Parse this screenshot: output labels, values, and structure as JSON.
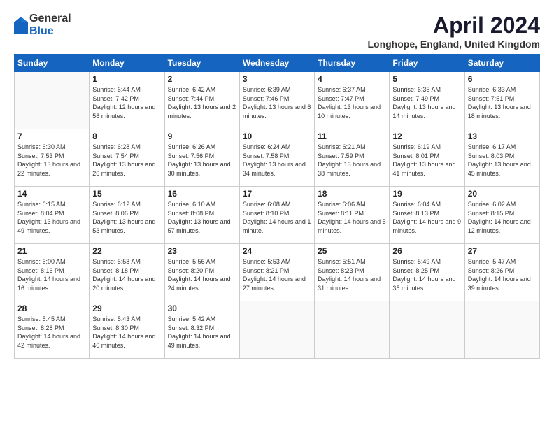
{
  "logo": {
    "general": "General",
    "blue": "Blue"
  },
  "title": "April 2024",
  "location": "Longhope, England, United Kingdom",
  "days_header": [
    "Sunday",
    "Monday",
    "Tuesday",
    "Wednesday",
    "Thursday",
    "Friday",
    "Saturday"
  ],
  "weeks": [
    [
      {
        "day": "",
        "sunrise": "",
        "sunset": "",
        "daylight": ""
      },
      {
        "day": "1",
        "sunrise": "Sunrise: 6:44 AM",
        "sunset": "Sunset: 7:42 PM",
        "daylight": "Daylight: 12 hours and 58 minutes."
      },
      {
        "day": "2",
        "sunrise": "Sunrise: 6:42 AM",
        "sunset": "Sunset: 7:44 PM",
        "daylight": "Daylight: 13 hours and 2 minutes."
      },
      {
        "day": "3",
        "sunrise": "Sunrise: 6:39 AM",
        "sunset": "Sunset: 7:46 PM",
        "daylight": "Daylight: 13 hours and 6 minutes."
      },
      {
        "day": "4",
        "sunrise": "Sunrise: 6:37 AM",
        "sunset": "Sunset: 7:47 PM",
        "daylight": "Daylight: 13 hours and 10 minutes."
      },
      {
        "day": "5",
        "sunrise": "Sunrise: 6:35 AM",
        "sunset": "Sunset: 7:49 PM",
        "daylight": "Daylight: 13 hours and 14 minutes."
      },
      {
        "day": "6",
        "sunrise": "Sunrise: 6:33 AM",
        "sunset": "Sunset: 7:51 PM",
        "daylight": "Daylight: 13 hours and 18 minutes."
      }
    ],
    [
      {
        "day": "7",
        "sunrise": "Sunrise: 6:30 AM",
        "sunset": "Sunset: 7:53 PM",
        "daylight": "Daylight: 13 hours and 22 minutes."
      },
      {
        "day": "8",
        "sunrise": "Sunrise: 6:28 AM",
        "sunset": "Sunset: 7:54 PM",
        "daylight": "Daylight: 13 hours and 26 minutes."
      },
      {
        "day": "9",
        "sunrise": "Sunrise: 6:26 AM",
        "sunset": "Sunset: 7:56 PM",
        "daylight": "Daylight: 13 hours and 30 minutes."
      },
      {
        "day": "10",
        "sunrise": "Sunrise: 6:24 AM",
        "sunset": "Sunset: 7:58 PM",
        "daylight": "Daylight: 13 hours and 34 minutes."
      },
      {
        "day": "11",
        "sunrise": "Sunrise: 6:21 AM",
        "sunset": "Sunset: 7:59 PM",
        "daylight": "Daylight: 13 hours and 38 minutes."
      },
      {
        "day": "12",
        "sunrise": "Sunrise: 6:19 AM",
        "sunset": "Sunset: 8:01 PM",
        "daylight": "Daylight: 13 hours and 41 minutes."
      },
      {
        "day": "13",
        "sunrise": "Sunrise: 6:17 AM",
        "sunset": "Sunset: 8:03 PM",
        "daylight": "Daylight: 13 hours and 45 minutes."
      }
    ],
    [
      {
        "day": "14",
        "sunrise": "Sunrise: 6:15 AM",
        "sunset": "Sunset: 8:04 PM",
        "daylight": "Daylight: 13 hours and 49 minutes."
      },
      {
        "day": "15",
        "sunrise": "Sunrise: 6:12 AM",
        "sunset": "Sunset: 8:06 PM",
        "daylight": "Daylight: 13 hours and 53 minutes."
      },
      {
        "day": "16",
        "sunrise": "Sunrise: 6:10 AM",
        "sunset": "Sunset: 8:08 PM",
        "daylight": "Daylight: 13 hours and 57 minutes."
      },
      {
        "day": "17",
        "sunrise": "Sunrise: 6:08 AM",
        "sunset": "Sunset: 8:10 PM",
        "daylight": "Daylight: 14 hours and 1 minute."
      },
      {
        "day": "18",
        "sunrise": "Sunrise: 6:06 AM",
        "sunset": "Sunset: 8:11 PM",
        "daylight": "Daylight: 14 hours and 5 minutes."
      },
      {
        "day": "19",
        "sunrise": "Sunrise: 6:04 AM",
        "sunset": "Sunset: 8:13 PM",
        "daylight": "Daylight: 14 hours and 9 minutes."
      },
      {
        "day": "20",
        "sunrise": "Sunrise: 6:02 AM",
        "sunset": "Sunset: 8:15 PM",
        "daylight": "Daylight: 14 hours and 12 minutes."
      }
    ],
    [
      {
        "day": "21",
        "sunrise": "Sunrise: 6:00 AM",
        "sunset": "Sunset: 8:16 PM",
        "daylight": "Daylight: 14 hours and 16 minutes."
      },
      {
        "day": "22",
        "sunrise": "Sunrise: 5:58 AM",
        "sunset": "Sunset: 8:18 PM",
        "daylight": "Daylight: 14 hours and 20 minutes."
      },
      {
        "day": "23",
        "sunrise": "Sunrise: 5:56 AM",
        "sunset": "Sunset: 8:20 PM",
        "daylight": "Daylight: 14 hours and 24 minutes."
      },
      {
        "day": "24",
        "sunrise": "Sunrise: 5:53 AM",
        "sunset": "Sunset: 8:21 PM",
        "daylight": "Daylight: 14 hours and 27 minutes."
      },
      {
        "day": "25",
        "sunrise": "Sunrise: 5:51 AM",
        "sunset": "Sunset: 8:23 PM",
        "daylight": "Daylight: 14 hours and 31 minutes."
      },
      {
        "day": "26",
        "sunrise": "Sunrise: 5:49 AM",
        "sunset": "Sunset: 8:25 PM",
        "daylight": "Daylight: 14 hours and 35 minutes."
      },
      {
        "day": "27",
        "sunrise": "Sunrise: 5:47 AM",
        "sunset": "Sunset: 8:26 PM",
        "daylight": "Daylight: 14 hours and 39 minutes."
      }
    ],
    [
      {
        "day": "28",
        "sunrise": "Sunrise: 5:45 AM",
        "sunset": "Sunset: 8:28 PM",
        "daylight": "Daylight: 14 hours and 42 minutes."
      },
      {
        "day": "29",
        "sunrise": "Sunrise: 5:43 AM",
        "sunset": "Sunset: 8:30 PM",
        "daylight": "Daylight: 14 hours and 46 minutes."
      },
      {
        "day": "30",
        "sunrise": "Sunrise: 5:42 AM",
        "sunset": "Sunset: 8:32 PM",
        "daylight": "Daylight: 14 hours and 49 minutes."
      },
      {
        "day": "",
        "sunrise": "",
        "sunset": "",
        "daylight": ""
      },
      {
        "day": "",
        "sunrise": "",
        "sunset": "",
        "daylight": ""
      },
      {
        "day": "",
        "sunrise": "",
        "sunset": "",
        "daylight": ""
      },
      {
        "day": "",
        "sunrise": "",
        "sunset": "",
        "daylight": ""
      }
    ]
  ]
}
